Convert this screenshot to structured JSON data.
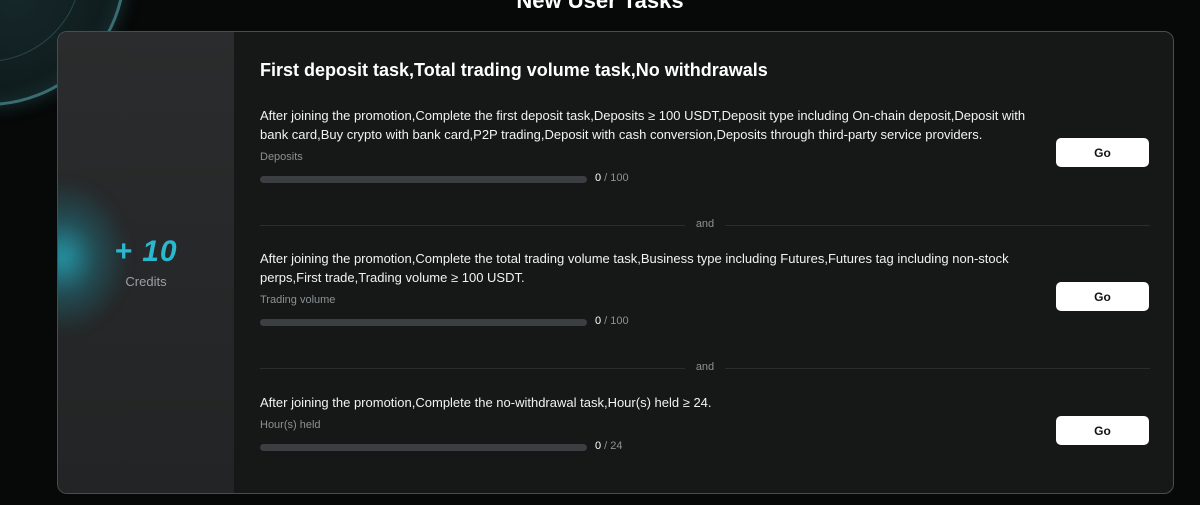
{
  "section_title": "New User Tasks",
  "reward": {
    "amount": "+ 10",
    "label": "Credits"
  },
  "task_group_title": "First deposit task,Total trading volume task,No withdrawals",
  "separator_text": "and",
  "tasks": [
    {
      "description": "After joining the promotion,Complete the first deposit task,Deposits ≥ 100 USDT,Deposit type including On-chain deposit,Deposit with bank card,Buy crypto with bank card,P2P trading,Deposit with cash conversion,Deposits through third-party service providers.",
      "metric_label": "Deposits",
      "current": "0",
      "target": "100",
      "progress_fraction": 0,
      "button_label": "Go"
    },
    {
      "description": "After joining the promotion,Complete the total trading volume task,Business type including Futures,Futures tag including non-stock perps,First trade,Trading volume ≥ 100 USDT.",
      "metric_label": "Trading volume",
      "current": "0",
      "target": "100",
      "progress_fraction": 0,
      "button_label": "Go"
    },
    {
      "description": "After joining the promotion,Complete the no-withdrawal task,Hour(s) held ≥ 24.",
      "metric_label": "Hour(s) held",
      "current": "0",
      "target": "24",
      "progress_fraction": 0,
      "button_label": "Go"
    }
  ],
  "colors": {
    "accent": "#2ab8cf",
    "card_background": "#161717",
    "page_background": "#070808",
    "button_background": "#ffffff"
  }
}
